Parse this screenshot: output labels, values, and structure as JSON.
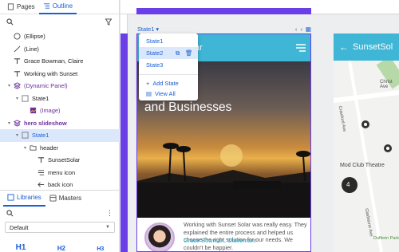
{
  "tabs": {
    "pages": "Pages",
    "outline": "Outline"
  },
  "tree": [
    {
      "label": "(Ellipse)",
      "icon": "ellipse-icon",
      "indent": 0,
      "twisty": ""
    },
    {
      "label": "(Line)",
      "icon": "line-icon",
      "indent": 0,
      "twisty": ""
    },
    {
      "label": "Grace Bowman, Claire",
      "icon": "text-icon",
      "indent": 0,
      "twisty": ""
    },
    {
      "label": "Working with Sunset",
      "icon": "text-icon",
      "indent": 0,
      "twisty": ""
    },
    {
      "label": "(Dynamic Panel)",
      "icon": "dynamic-panel-icon",
      "indent": 0,
      "twisty": "▾",
      "color": "purple"
    },
    {
      "label": "State1",
      "icon": "state-icon",
      "indent": 1,
      "twisty": "▾"
    },
    {
      "label": "(Image)",
      "icon": "image-icon",
      "indent": 2,
      "twisty": "",
      "color": "purple"
    },
    {
      "label": "hero slideshow",
      "icon": "dynamic-panel-icon",
      "indent": 0,
      "twisty": "▾",
      "color": "purple",
      "bold": true
    },
    {
      "label": "State1",
      "icon": "state-icon",
      "indent": 1,
      "twisty": "▾",
      "selected": true,
      "color": "blue"
    },
    {
      "label": "header",
      "icon": "folder-icon",
      "indent": 2,
      "twisty": "▾"
    },
    {
      "label": "SunsetSolar",
      "icon": "text-icon",
      "indent": 3,
      "twisty": ""
    },
    {
      "label": "menu icon",
      "icon": "menu-icon",
      "indent": 3,
      "twisty": ""
    },
    {
      "label": "back icon",
      "icon": "back-arrow-icon",
      "indent": 3,
      "twisty": ""
    }
  ],
  "libraries": {
    "libraries": "Libraries",
    "masters": "Masters",
    "dropdown": "Default",
    "tiles": [
      "H1",
      "H2",
      "H3"
    ]
  },
  "canvas": {
    "statebar": "State1",
    "menu": {
      "items": [
        "State1",
        "State2",
        "State3"
      ],
      "add": "Add State",
      "view": "View All"
    },
    "brand": "Solar",
    "headline": "olutions\nsidential\ners\nand Businesses",
    "quote": "Working with Sunset Solar was really easy. They explained the entire process and helped us choose the right solution for our needs. We couldn't be happier.",
    "author": "Grace Bowman, Clairemont"
  },
  "artboard2": {
    "brand": "SunsetSol",
    "map_labels": [
      "Mod Club Theatre",
      "Crawford Ave",
      "Gladstone Ave",
      "Dufferin Park",
      "Christ Ave"
    ],
    "map_badge": "4"
  },
  "colors": {
    "accent": "#1a5fd3",
    "ruler": "#6a3fe8",
    "header": "#3fb6d6",
    "panel": "#6b2f9e"
  }
}
